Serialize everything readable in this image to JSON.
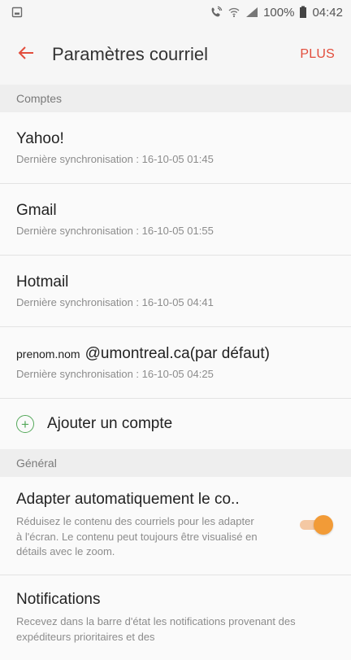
{
  "status_bar": {
    "left_icon": "image-icon",
    "battery_text": "100%",
    "time": "04:42",
    "icons": [
      "phone-wifi-icon",
      "wifi-icon",
      "signal-icon",
      "battery-icon"
    ]
  },
  "header": {
    "title": "Paramètres courriel",
    "more_label": "PLUS"
  },
  "sections": {
    "accounts": {
      "header": "Comptes",
      "items": [
        {
          "title": "Yahoo!",
          "subtitle": "Dernière synchronisation : 16-10-05 01:45"
        },
        {
          "title": "Gmail",
          "subtitle": "Dernière synchronisation : 16-10-05 01:55"
        },
        {
          "title": "Hotmail",
          "subtitle": "Dernière synchronisation : 16-10-05 04:41"
        }
      ],
      "primary_account": {
        "title_prefix": "prenom.nom",
        "title_suffix": "@umontreal.ca(par défaut)",
        "subtitle": "Dernière synchronisation : 16-10-05 04:25"
      },
      "add_account_label": "Ajouter un compte"
    },
    "general": {
      "header": "Général",
      "adapt": {
        "title": "Adapter automatiquement le co..",
        "desc": "Réduisez le contenu des courriels pour les adapter à l'écran. Le contenu peut toujours être visualisé en détails avec le zoom.",
        "enabled": true
      },
      "notifications": {
        "title": "Notifications",
        "desc": "Recevez dans la barre d'état les notifications provenant des expéditeurs prioritaires et des"
      }
    }
  },
  "colors": {
    "accent": "#e24d3c",
    "toggle_on": "#f29b37",
    "toggle_track": "#f4c8a3",
    "add_green": "#54a85a",
    "section_bg": "#eeeeee"
  }
}
